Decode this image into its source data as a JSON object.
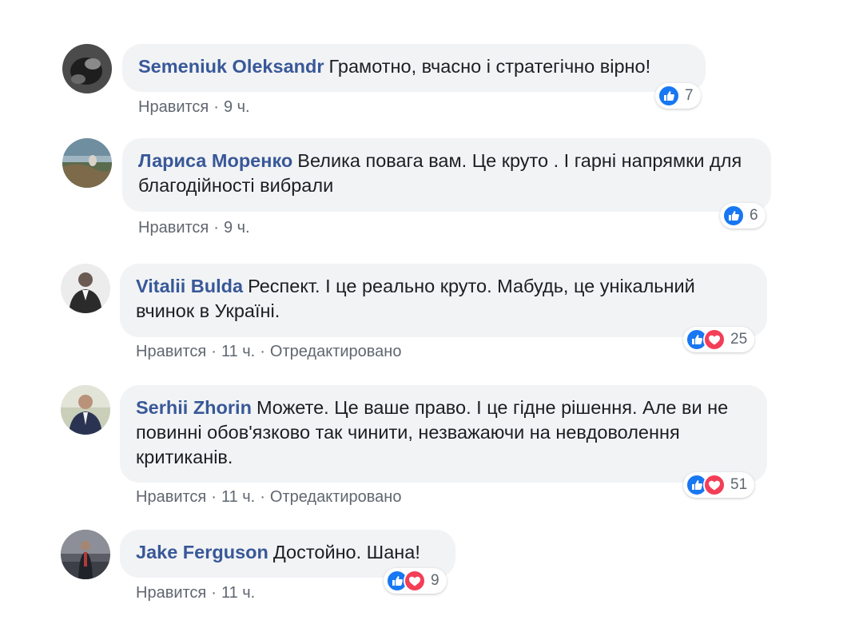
{
  "colors": {
    "author": "#385898",
    "bubble": "#f2f3f5",
    "meta": "#606770",
    "like": "#1877f2",
    "love": "#f33e58"
  },
  "comments": [
    {
      "author": "Semeniuk Oleksandr",
      "text": "Грамотно, вчасно і стратегічно вірно!",
      "like_label": "Нравится",
      "time": "9 ч.",
      "edited": "",
      "reactions": [
        "like-icon"
      ],
      "reaction_count": "7"
    },
    {
      "author": "Лариса Моренко",
      "text": "Велика повага вам. Це круто . І гарні напрямки для благодійності вибрали",
      "like_label": "Нравится",
      "time": "9 ч.",
      "edited": "",
      "reactions": [
        "like-icon"
      ],
      "reaction_count": "6"
    },
    {
      "author": "Vitalii Bulda",
      "text": "Респект. І це реально круто. Мабудь, це унікальний вчинок в Україні.",
      "like_label": "Нравится",
      "time": "11 ч.",
      "edited": "Отредактировано",
      "reactions": [
        "like-icon",
        "love-icon"
      ],
      "reaction_count": "25"
    },
    {
      "author": "Serhii Zhorin",
      "text": "Можете. Це ваше право. І це гідне рішення. Але ви не повинні обов'язково так чинити, незважаючи на невдоволення критиканів.",
      "like_label": "Нравится",
      "time": "11 ч.",
      "edited": "Отредактировано",
      "reactions": [
        "like-icon",
        "love-icon"
      ],
      "reaction_count": "51"
    },
    {
      "author": "Jake Ferguson",
      "text": "Достойно. Шана!",
      "like_label": "Нравится",
      "time": "11 ч.",
      "edited": "",
      "reactions": [
        "like-icon",
        "love-icon"
      ],
      "reaction_count": "9"
    }
  ]
}
